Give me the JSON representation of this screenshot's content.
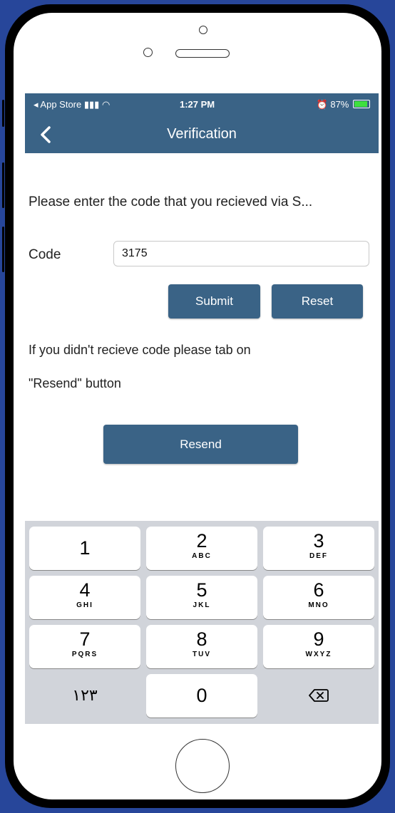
{
  "status_bar": {
    "back_app": "◂ App Store",
    "time": "1:27 PM",
    "battery": "87%"
  },
  "nav": {
    "title": "Verification"
  },
  "form": {
    "prompt": "Please enter the code that you recieved via S...",
    "code_label": "Code",
    "code_value": "3175",
    "submit_label": "Submit",
    "reset_label": "Reset",
    "info_line1": "If you didn't recieve code please tab on",
    "info_line2": "\"Resend\" button",
    "resend_label": "Resend"
  },
  "keypad": {
    "keys": [
      {
        "num": "1",
        "letters": ""
      },
      {
        "num": "2",
        "letters": "ABC"
      },
      {
        "num": "3",
        "letters": "DEF"
      },
      {
        "num": "4",
        "letters": "GHI"
      },
      {
        "num": "5",
        "letters": "JKL"
      },
      {
        "num": "6",
        "letters": "MNO"
      },
      {
        "num": "7",
        "letters": "PQRS"
      },
      {
        "num": "8",
        "letters": "TUV"
      },
      {
        "num": "9",
        "letters": "WXYZ"
      },
      {
        "num": "١٢٣",
        "letters": ""
      },
      {
        "num": "0",
        "letters": ""
      },
      {
        "num": "",
        "letters": ""
      }
    ]
  },
  "colors": {
    "accent": "#3a6386",
    "background": "#27469a",
    "keypad_bg": "#d1d4da"
  }
}
